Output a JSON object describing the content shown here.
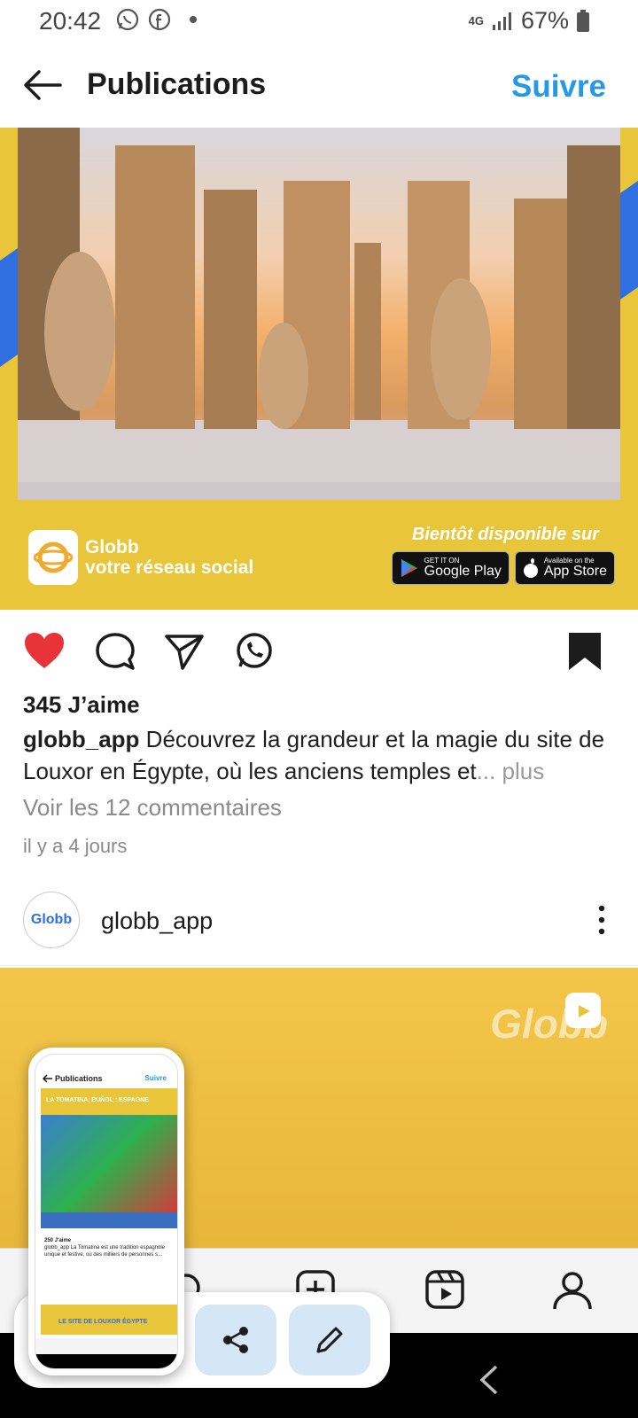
{
  "status_bar": {
    "time": "20:42",
    "network": "4G",
    "battery": "67%",
    "left_icons": [
      "whatsapp-icon",
      "facebook-icon"
    ]
  },
  "header": {
    "title": "Publications",
    "follow_label": "Suivre"
  },
  "post1": {
    "brand_name": "Globb",
    "brand_tagline": "votre réseau social",
    "coming_soon": "Bientôt disponible sur",
    "google_play_small": "GET IT ON",
    "google_play_large": "Google Play",
    "app_store_small": "Available on the",
    "app_store_large": "App Store",
    "likes": "345 J’aime",
    "username": "globb_app",
    "caption": "Découvrez la grandeur et la magie du site de Louxor en Égypte, où les anciens temples et",
    "more_label": "... plus",
    "comments_link": "Voir les 12 commentaires",
    "time_ago": "il y a 4 jours",
    "liked": true,
    "saved": true
  },
  "post2": {
    "avatar_text": "Globb",
    "username": "globb_app",
    "watermark": "Globb"
  },
  "thumbnail": {
    "title": "Publications",
    "follow": "Suivre",
    "banner": "LA TOMATINA, BUÑOL : ESPAGNE",
    "likes": "250 J'aime",
    "caption": "globb_app La Tomatina est une tradition espagnole unique et festive, où des milliers de personnes s...",
    "banner2": "LE SITE DE LOUXOR ÉGYPTE"
  },
  "colors": {
    "accent_blue": "#2699e6",
    "brand_yellow": "#e9c53a",
    "like_red": "#e8333b"
  }
}
